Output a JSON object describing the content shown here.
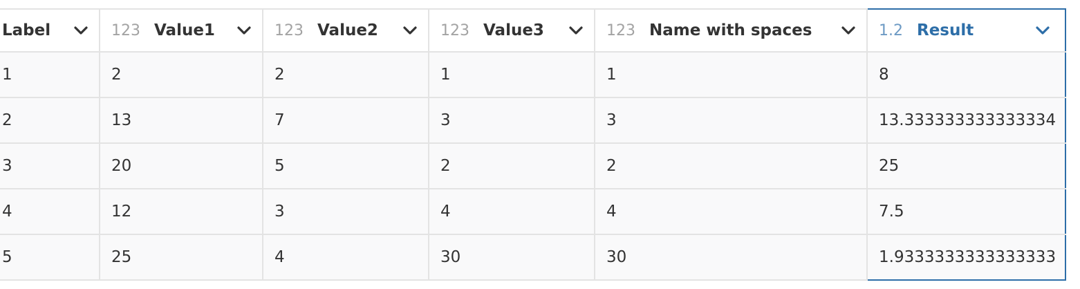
{
  "colors": {
    "border": "#e3e3e3",
    "cell_bg": "#f9f9fa",
    "selected_accent": "#2d6ea8",
    "type_badge": "#a3a3a3"
  },
  "columns": [
    {
      "type": "",
      "name": "Label",
      "icon": "chevron-down-icon"
    },
    {
      "type": "123",
      "name": "Value1",
      "icon": "chevron-down-icon"
    },
    {
      "type": "123",
      "name": "Value2",
      "icon": "chevron-down-icon"
    },
    {
      "type": "123",
      "name": "Value3",
      "icon": "chevron-down-icon"
    },
    {
      "type": "123",
      "name": "Name with spaces",
      "icon": "chevron-down-icon"
    },
    {
      "type": "1.2",
      "name": "Result",
      "icon": "chevron-down-icon",
      "selected": true
    }
  ],
  "rows": [
    {
      "label": "1",
      "value1": "2",
      "value2": "2",
      "value3": "1",
      "name_with_spaces": "1",
      "result": "8"
    },
    {
      "label": "2",
      "value1": "13",
      "value2": "7",
      "value3": "3",
      "name_with_spaces": "3",
      "result": "13.333333333333334"
    },
    {
      "label": "3",
      "value1": "20",
      "value2": "5",
      "value3": "2",
      "name_with_spaces": "2",
      "result": "25"
    },
    {
      "label": "4",
      "value1": "12",
      "value2": "3",
      "value3": "4",
      "name_with_spaces": "4",
      "result": "7.5"
    },
    {
      "label": "5",
      "value1": "25",
      "value2": "4",
      "value3": "30",
      "name_with_spaces": "30",
      "result": "1.9333333333333333"
    }
  ]
}
